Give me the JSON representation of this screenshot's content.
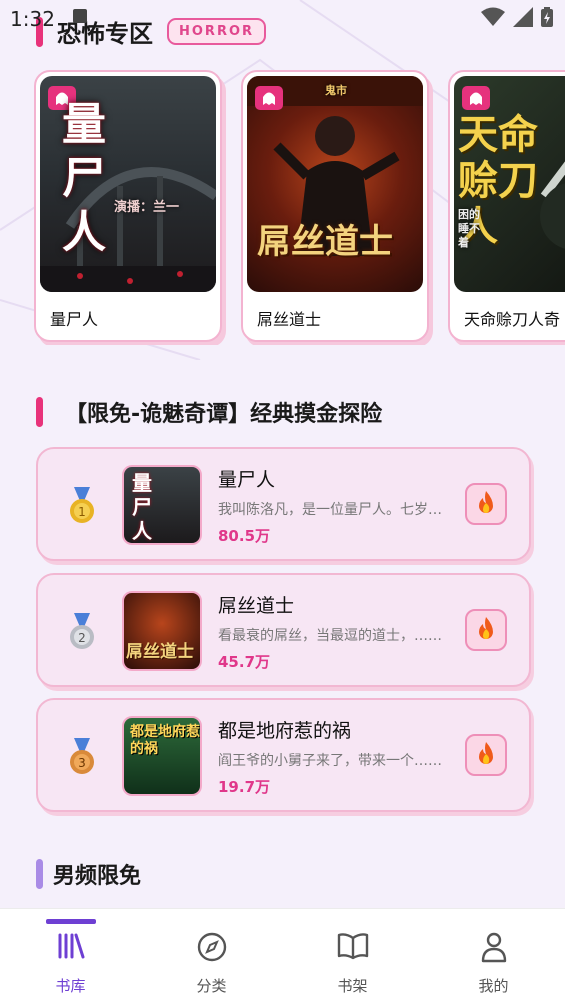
{
  "status_bar": {
    "time": "1:32"
  },
  "horror_section": {
    "title": "恐怖专区",
    "badge": "HORROR"
  },
  "horror_books": [
    {
      "name": "量尸人",
      "cover_text": "量尸人",
      "cover_sub": "演播：兰一"
    },
    {
      "name": "屌丝道士",
      "cover_text": "屌丝道士",
      "cover_sub": "鬼市"
    },
    {
      "name": "天命赊刀人奇",
      "cover_text": "天命赊刀人",
      "cover_sub": "困的睡不着"
    }
  ],
  "rank_section": {
    "title": "【限免-诡魅奇谭】经典摸金探险"
  },
  "rank_list": [
    {
      "rank": "1",
      "title": "量尸人",
      "desc": "我叫陈洛凡，是一位量尸人。七岁那年……",
      "count": "80.5万",
      "medal_color": "#e8b325",
      "thumb_text": "量尸人"
    },
    {
      "rank": "2",
      "title": "屌丝道士",
      "desc": "看最衰的屌丝，当最逗的道士，……",
      "count": "45.7万",
      "medal_color": "#b9bcc4",
      "thumb_text": "屌丝道士"
    },
    {
      "rank": "3",
      "title": "都是地府惹的祸",
      "desc": "阎王爷的小舅子来了，带来一个……",
      "count": "19.7万",
      "medal_color": "#d98a3a",
      "thumb_text": "都是地府惹的祸"
    }
  ],
  "male_section": {
    "title": "男频限免"
  },
  "tabs": [
    {
      "label": "书库",
      "icon": "library-icon",
      "active": true
    },
    {
      "label": "分类",
      "icon": "compass-icon",
      "active": false
    },
    {
      "label": "书架",
      "icon": "book-open-icon",
      "active": false
    },
    {
      "label": "我的",
      "icon": "person-icon",
      "active": false
    }
  ],
  "colors": {
    "accent": "#6e3fd3",
    "pink": "#e0378a",
    "pink_bar": "#e8327a",
    "purple_bar": "#a98be6"
  }
}
